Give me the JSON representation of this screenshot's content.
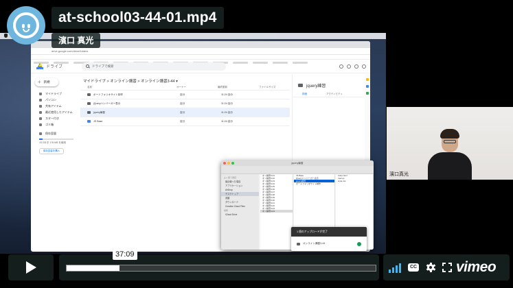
{
  "player": {
    "title": "at-school03-44-01.mp4",
    "owner": "濱口 真光",
    "current_time": "37:09",
    "progress": 0.17,
    "brand": "vimeo",
    "cc_label": "CC",
    "accent_color": "#3db8f5",
    "icons": [
      "play-icon",
      "volume-icon",
      "cc-icon",
      "gear-icon",
      "fullscreen-icon",
      "vimeo-logo"
    ]
  },
  "screen": {
    "browser_url": "drive.google.com/drive/folders",
    "drive": {
      "app_name": "ドライブ",
      "search_placeholder": "ドライブで検索",
      "new_button": "新規",
      "nav": [
        "マイドライブ",
        "パソコン",
        "共有アイテム",
        "最近使用したアイテム",
        "スター付き",
        "ゴミ箱",
        "保存容量"
      ],
      "quota_text": "15 GB 中 176 MB を使用",
      "buy_storage": "保存容量を購入",
      "breadcrumb": "マイドライブ  >  オンライン講習  >  オンライン講習3-44  ▾",
      "columns": [
        "名前",
        "オーナー",
        "最終更新",
        "ファイルサイズ"
      ],
      "files": [
        {
          "name": "ポートフォリオサイト制作",
          "owner": "自分",
          "date": "11:24 自分",
          "selected": false,
          "kind": "folder"
        },
        {
          "name": "jQueryハンバーガー表示",
          "owner": "自分",
          "date": "11:24 自分",
          "selected": false,
          "kind": "folder"
        },
        {
          "name": "jquery練習",
          "owner": "自分",
          "date": "11:24 自分",
          "selected": true,
          "kind": "folder"
        },
        {
          "name": "JS Base",
          "owner": "自分",
          "date": "11:24 自分",
          "selected": false,
          "kind": "doc"
        }
      ],
      "details_title": "jquery練習",
      "details_tabs": [
        "詳細",
        "アクティビティ"
      ]
    },
    "finder": {
      "title": "jquery練習",
      "sidebar": [
        "よく使う項目",
        "最近使った項目",
        "アプリケーション",
        "AirDrop",
        "デスクトップ",
        "書類",
        "ダウンロード",
        "Creative Cloud Files",
        "iCloud Drive",
        "場所"
      ],
      "col1": [
        "オン講習3-31",
        "オン講習3-32",
        "オン講習3-33",
        "オン講習3-34",
        "オン講習3-35",
        "オン講習3-36",
        "オン講習3-37",
        "オン講習3-38",
        "オン講習3-39",
        "オン講習3-40",
        "オン講習3-41",
        "オン講習3-42",
        "オン講習3-43",
        "オン講習3-44"
      ],
      "col2": [
        "JS Base",
        "jQueryハンバーガー表示",
        "jquery練習",
        "ポートフォリオサイト制作"
      ],
      "col3": [
        "index.html",
        "main.js",
        "style.css"
      ]
    },
    "upload_toast": {
      "title": "1 個のアップロードが完了",
      "file": "オンライン講習3-44"
    },
    "webcam_name": "濱口真光"
  }
}
